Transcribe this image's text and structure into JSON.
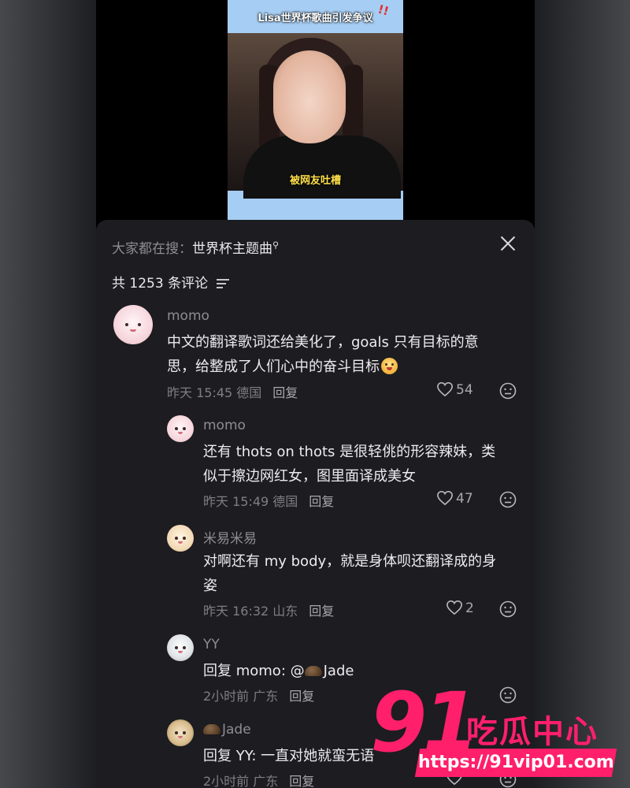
{
  "video": {
    "title": "Lisa世界杯歌曲引发争议",
    "caption": "被网友吐槽"
  },
  "header": {
    "search_prefix": "大家都在搜：",
    "search_keyword": "世界杯主题曲",
    "comment_count_label": "共 1253 条评论"
  },
  "comments": [
    {
      "user": "momo",
      "text_line1": "中文的翻译歌词还给美化了，goals 只有目标的意",
      "text_line2": "思，给整成了人们心中的奋斗目标",
      "time": "昨天 15:45 德国",
      "reply_label": "回复",
      "likes": "54"
    },
    {
      "user": "momo",
      "text_line1": "还有 thots on thots 是很轻佻的形容辣妹，类",
      "text_line2": "似于擦边网红女，图里面译成美女",
      "time": "昨天 15:49 德国",
      "reply_label": "回复",
      "likes": "47"
    },
    {
      "user": "米易米易",
      "text_line1": "对啊还有 my body，就是身体呗还翻译成的身",
      "text_line2": "姿",
      "time": "昨天 16:32 山东",
      "reply_label": "回复",
      "likes": "2"
    },
    {
      "user": "YY",
      "text_line1": "回复 momo: @",
      "mention": "Jade",
      "time": "2小时前 广东",
      "reply_label": "回复"
    },
    {
      "user": "Jade",
      "text_line1": "回复 YY: 一直对她就蛮无语",
      "time": "2小时前 广东",
      "reply_label": "回复"
    }
  ],
  "watermark": {
    "number": "91",
    "text": "吃瓜中心",
    "url": "https://91vip01.com"
  },
  "colors": {
    "sheet_bg": "#1c1c21",
    "accent_watermark": "#ff1f6a",
    "video_bg": "#a6cdf3"
  }
}
